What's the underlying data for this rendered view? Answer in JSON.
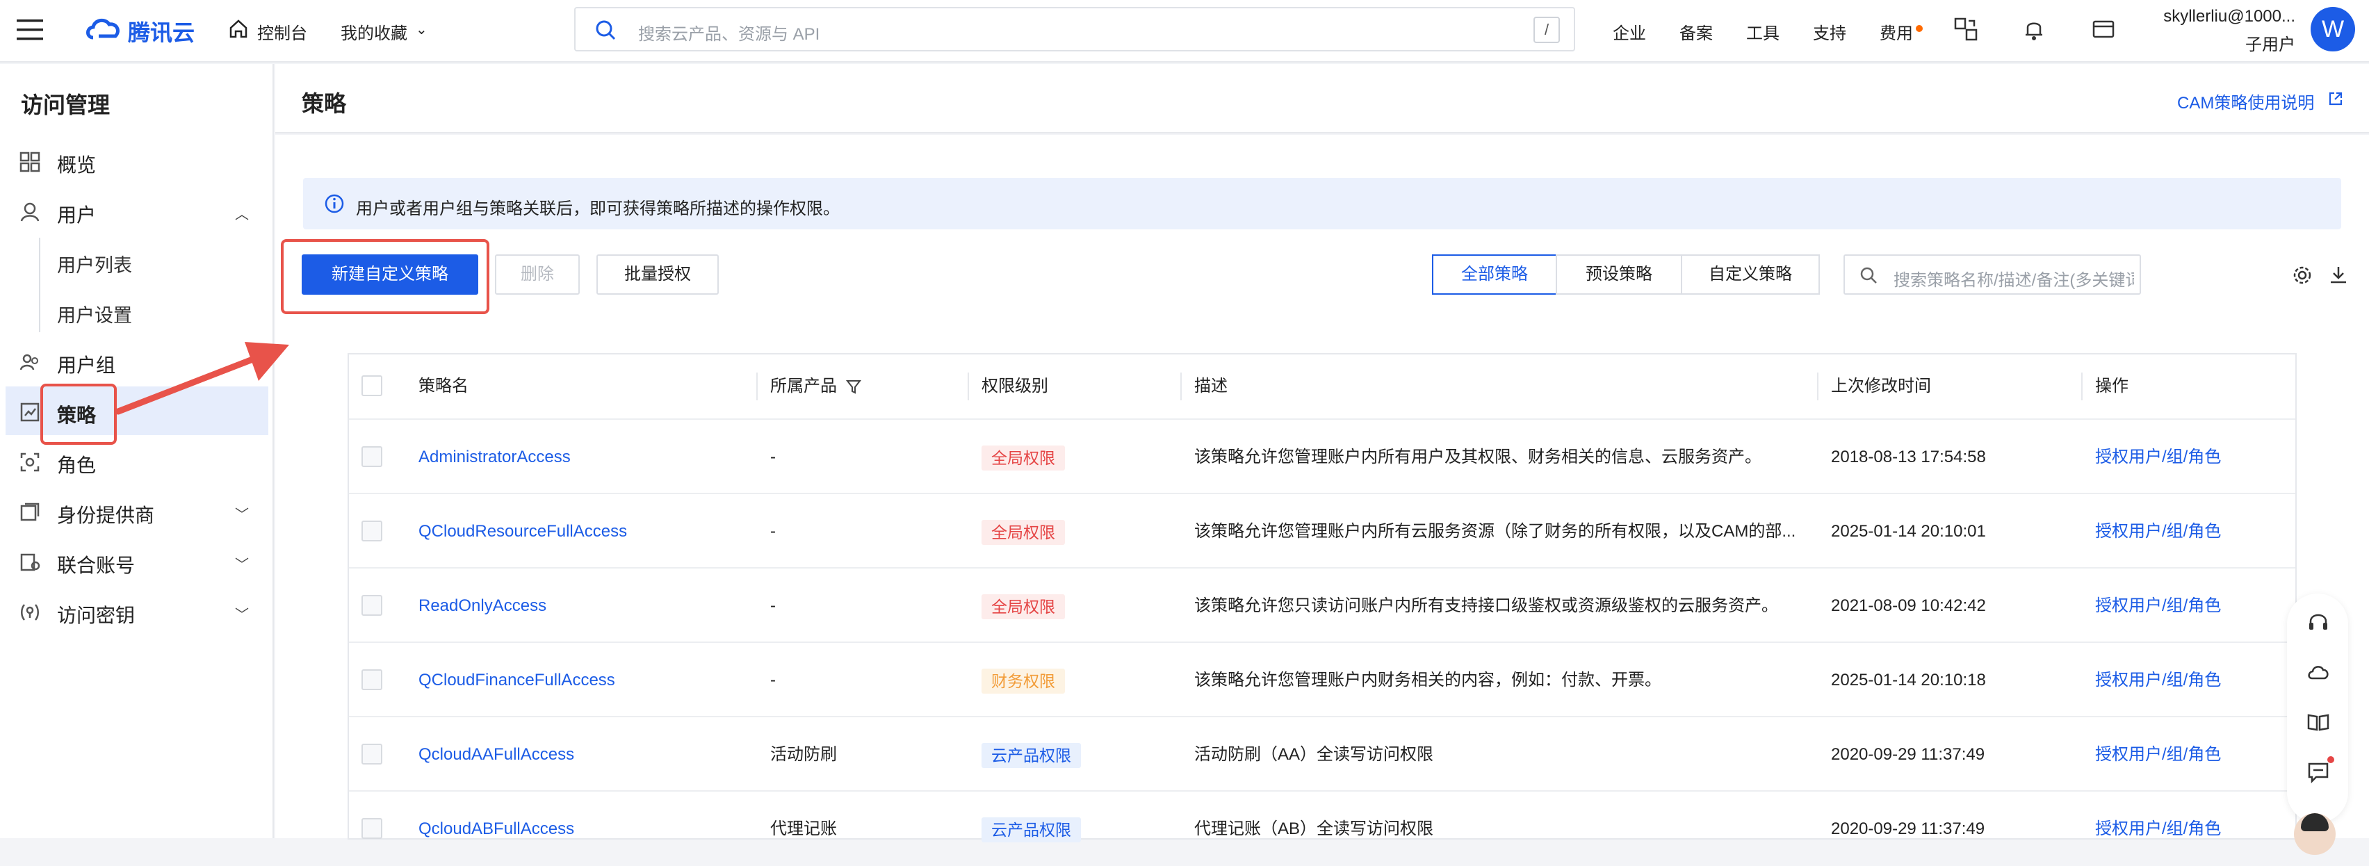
{
  "topbar": {
    "brand": "腾讯云",
    "console": "控制台",
    "favorites": "我的收藏",
    "search_placeholder": "搜索云产品、资源与 API",
    "search_shortcut": "/",
    "nav": [
      "企业",
      "备案",
      "工具",
      "支持",
      "费用"
    ],
    "user_name": "skyllerliu@1000...",
    "user_role": "子用户",
    "avatar_letter": "W"
  },
  "sidebar": {
    "title": "访问管理",
    "items": [
      {
        "label": "概览",
        "icon": "grid-icon"
      },
      {
        "label": "用户",
        "icon": "user-icon",
        "expanded": true
      },
      {
        "label": "用户列表",
        "sub": true
      },
      {
        "label": "用户设置",
        "sub": true
      },
      {
        "label": "用户组",
        "icon": "user-group-icon"
      },
      {
        "label": "策略",
        "icon": "policy-icon",
        "active": true
      },
      {
        "label": "角色",
        "icon": "role-icon"
      },
      {
        "label": "身份提供商",
        "icon": "identity-provider-icon",
        "collapsible": true
      },
      {
        "label": "联合账号",
        "icon": "federated-account-icon",
        "collapsible": true
      },
      {
        "label": "访问密钥",
        "icon": "key-icon",
        "collapsible": true
      }
    ]
  },
  "page": {
    "title": "策略",
    "help_link": "CAM策略使用说明",
    "info": "用户或者用户组与策略关联后，即可获得策略所描述的操作权限。",
    "buttons": {
      "create": "新建自定义策略",
      "delete": "删除",
      "batch": "批量授权"
    },
    "filters": [
      "全部策略",
      "预设策略",
      "自定义策略"
    ],
    "active_filter": "全部策略",
    "table_search_placeholder": "搜索策略名称/描述/备注(多关键词空格隔开)"
  },
  "table": {
    "headers": [
      "策略名",
      "所属产品",
      "权限级别",
      "描述",
      "上次修改时间",
      "操作"
    ],
    "rows": [
      {
        "name": "AdministratorAccess",
        "product": "-",
        "level": "全局权限",
        "level_type": "global",
        "desc": "该策略允许您管理账户内所有用户及其权限、财务相关的信息、云服务资产。",
        "time": "2018-08-13 17:54:58",
        "action": "授权用户/组/角色"
      },
      {
        "name": "QCloudResourceFullAccess",
        "product": "-",
        "level": "全局权限",
        "level_type": "global",
        "desc": "该策略允许您管理账户内所有云服务资源（除了财务的所有权限，以及CAM的部...",
        "time": "2025-01-14 20:10:01",
        "action": "授权用户/组/角色"
      },
      {
        "name": "ReadOnlyAccess",
        "product": "-",
        "level": "全局权限",
        "level_type": "global",
        "desc": "该策略允许您只读访问账户内所有支持接口级鉴权或资源级鉴权的云服务资产。",
        "time": "2021-08-09 10:42:42",
        "action": "授权用户/组/角色"
      },
      {
        "name": "QCloudFinanceFullAccess",
        "product": "-",
        "level": "财务权限",
        "level_type": "finance",
        "desc": "该策略允许您管理账户内财务相关的内容，例如：付款、开票。",
        "time": "2025-01-14 20:10:18",
        "action": "授权用户/组/角色"
      },
      {
        "name": "QcloudAAFullAccess",
        "product": "活动防刷",
        "level": "云产品权限",
        "level_type": "product",
        "desc": "活动防刷（AA）全读写访问权限",
        "time": "2020-09-29 11:37:49",
        "action": "授权用户/组/角色"
      },
      {
        "name": "QcloudABFullAccess",
        "product": "代理记账",
        "level": "云产品权限",
        "level_type": "product",
        "desc": "代理记账（AB）全读写访问权限",
        "time": "2020-09-29 11:37:49",
        "action": "授权用户/组/角色"
      }
    ]
  },
  "colors": {
    "primary": "#1c5ce6",
    "annotation": "#e8534a",
    "tag_global_bg": "#fdeceb",
    "tag_global_fg": "#e54545",
    "tag_finance_bg": "#fdf3e3",
    "tag_finance_fg": "#f29c38",
    "tag_product_bg": "#e8f0fd",
    "tag_product_fg": "#1c5ce6"
  }
}
